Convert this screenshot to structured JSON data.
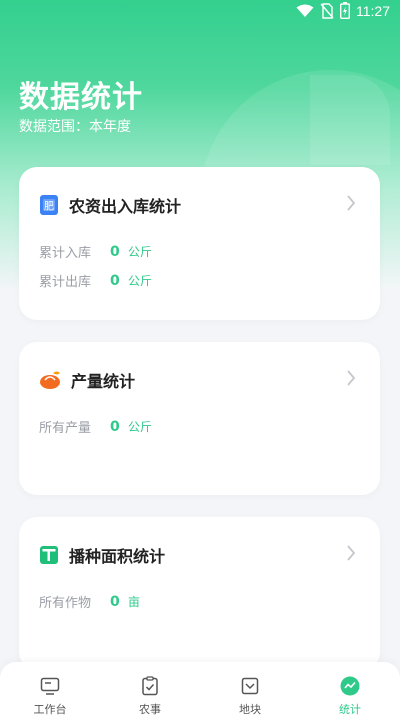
{
  "status": {
    "time": "11:27"
  },
  "page": {
    "title": "数据统计",
    "subtitle": "数据范围：本年度"
  },
  "cards": [
    {
      "title": "农资出入库统计",
      "icon_text": "肥",
      "rows": [
        {
          "label": "累计入库",
          "value": "0",
          "unit": "公斤"
        },
        {
          "label": "累计出库",
          "value": "0",
          "unit": "公斤"
        }
      ]
    },
    {
      "title": "产量统计",
      "rows": [
        {
          "label": "所有产量",
          "value": "0",
          "unit": "公斤"
        }
      ]
    },
    {
      "title": "播种面积统计",
      "rows": [
        {
          "label": "所有作物",
          "value": "0",
          "unit": "亩"
        }
      ]
    }
  ],
  "tabs": [
    {
      "label": "工作台",
      "icon": "monitor-icon"
    },
    {
      "label": "农事",
      "icon": "clipboard-check-icon"
    },
    {
      "label": "地块",
      "icon": "field-icon"
    },
    {
      "label": "统计",
      "icon": "chart-icon",
      "active": true
    }
  ],
  "colors": {
    "accent": "#2fc98a",
    "header": "#33d08e"
  }
}
